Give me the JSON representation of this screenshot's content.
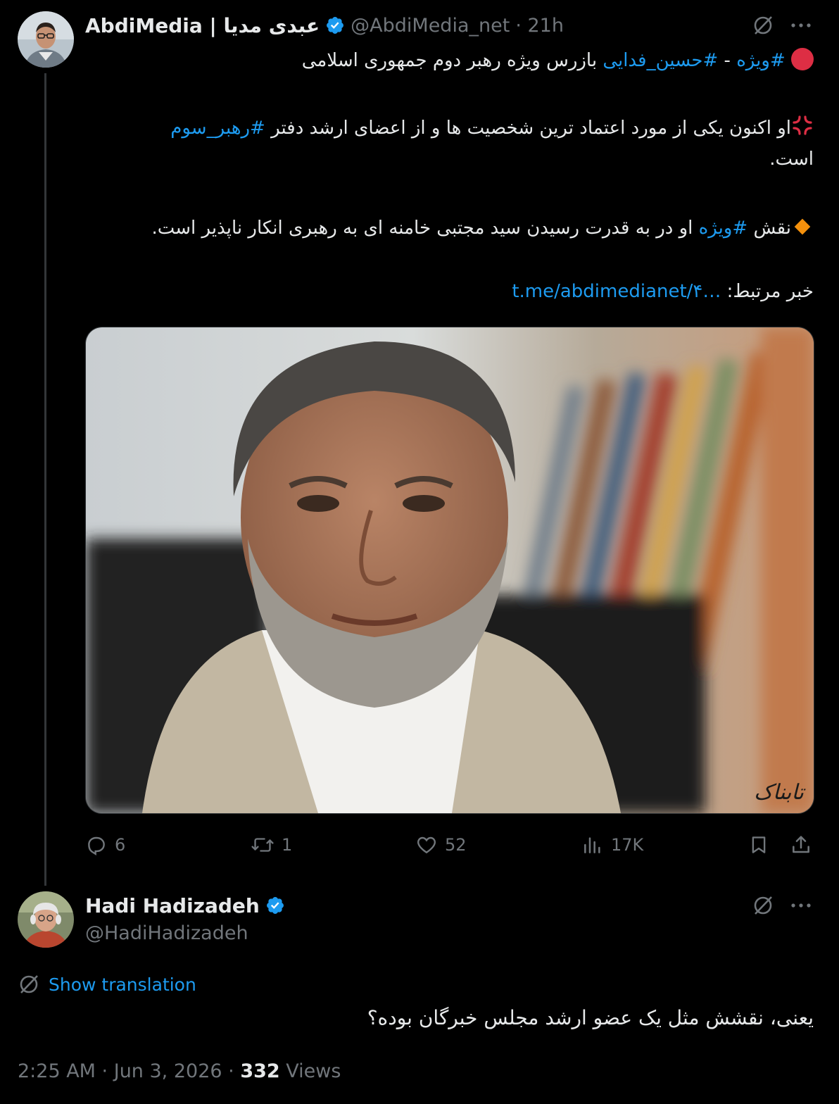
{
  "tweet": {
    "author_name": "AbdiMedia | عبدی مدیا",
    "handle": "@AbdiMedia_net",
    "time": "· 21h",
    "line1": {
      "hashtag1": "#ویژه",
      "sep": " - ",
      "hashtag2": "#حسین_فدایی",
      "rest": " بازرس ویژه رهبر دوم جمهوری اسلامی"
    },
    "line2": {
      "text": "او اکنون یکی از مورد اعتماد ترین شخصیت ها و از اعضای ارشد دفتر ",
      "hashtag": "#رهبر_سوم"
    },
    "line3": "است.",
    "line4": {
      "prefix": "نقش ",
      "hashtag": "#ویژه",
      "rest": " او در به قدرت رسیدن سید مجتبی خامنه ای به رهبری انکار ناپذیر است."
    },
    "line5": {
      "prefix": "خبر مرتبط: ",
      "link": "t.me/abdimedianet/۴…"
    },
    "watermark": "تابناک",
    "stats": {
      "replies": "6",
      "retweets": "1",
      "likes": "52",
      "views": "17K"
    }
  },
  "reply": {
    "author_name": "Hadi Hadizadeh",
    "handle": "@HadiHadizadeh",
    "show_translation": "Show translation",
    "text": "یعنی، نقشش مثل یک عضو ارشد مجلس خبرگان بوده؟",
    "timestamp": "2:25 AM · Jun 3, 2026 · ",
    "views_count": "332",
    "views_label": " Views"
  },
  "colors": {
    "accent": "#1d9bf0",
    "muted": "#71767b",
    "text": "#e7e9ea",
    "background": "#000000"
  },
  "icons": [
    "verified-badge-icon",
    "grok-icon",
    "more-icon",
    "reply-icon",
    "retweet-icon",
    "like-icon",
    "views-icon",
    "bookmark-icon",
    "share-icon",
    "translate-icon",
    "red-circle-emoji",
    "anger-emoji",
    "orange-diamond-emoji"
  ]
}
